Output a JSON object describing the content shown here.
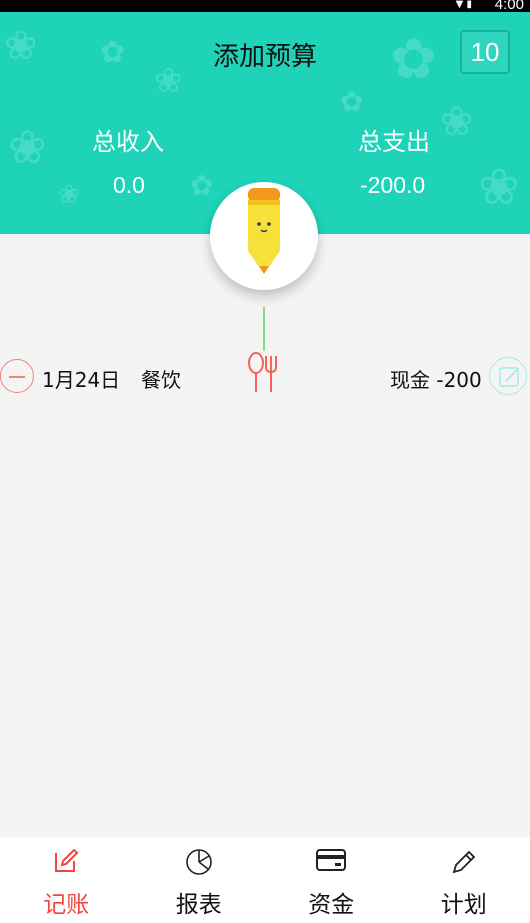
{
  "header": {
    "title": "添加预算",
    "calendar_day": "10",
    "income_label": "总收入",
    "income_value": "0.0",
    "expense_label": "总支出",
    "expense_value": "-200.0",
    "background_color": "#1ed3b8"
  },
  "records": [
    {
      "date": "1月24日",
      "category": "餐饮",
      "category_icon": "fork-knife-icon",
      "amount": "现金 -200"
    }
  ],
  "bottom_nav": {
    "items": [
      {
        "label": "记账",
        "icon": "edit-icon",
        "active": true
      },
      {
        "label": "报表",
        "icon": "pie-chart-icon",
        "active": false
      },
      {
        "label": "资金",
        "icon": "card-icon",
        "active": false
      },
      {
        "label": "计划",
        "icon": "pencil-icon",
        "active": false
      }
    ],
    "active_color": "#f2473f"
  }
}
